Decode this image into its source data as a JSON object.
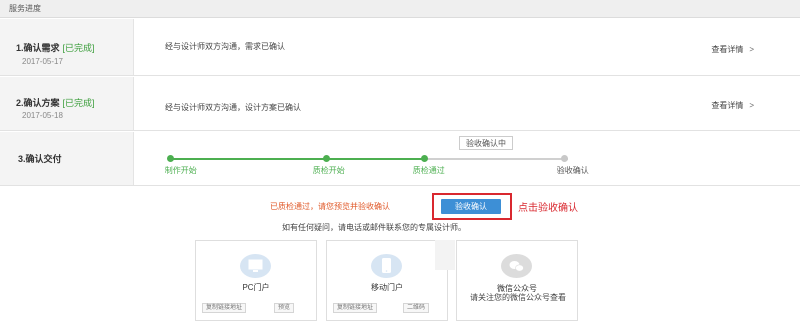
{
  "header": {
    "title": "服务进度"
  },
  "steps": [
    {
      "title": "1.确认需求",
      "status": "[已完成]",
      "date": "2017-05-17",
      "description": "经与设计师双方沟通，需求已确认",
      "detail": "查看详情",
      "chevron": ">"
    },
    {
      "title": "2.确认方案",
      "status": "[已完成]",
      "date": "2017-05-18",
      "description": "经与设计师双方沟通，设计方案已确认",
      "detail": "查看详情",
      "chevron": ">"
    },
    {
      "title": "3.确认交付"
    }
  ],
  "delivery": {
    "tip": "验收确认中",
    "stages": [
      {
        "label": "制作开始",
        "state": "done"
      },
      {
        "label": "质检开始",
        "state": "done"
      },
      {
        "label": "质检通过",
        "state": "done"
      },
      {
        "label": "验收确认",
        "state": "pending"
      }
    ]
  },
  "action": {
    "notice": "已质检通过，请您预览并验收确认",
    "confirm_button": "验收确认",
    "callout": "点击验收确认",
    "help": "如有任何疑问，请电话或邮件联系您的专属设计师。"
  },
  "cards": [
    {
      "title": "PC门户",
      "icon": "monitor-icon",
      "buttons": [
        "复制链接地址",
        "预览"
      ]
    },
    {
      "title": "移动门户",
      "icon": "mobile-icon",
      "buttons": [
        "复制链接地址",
        "二维码"
      ]
    },
    {
      "title": "微信公众号",
      "icon": "wechat-icon",
      "subtitle": "请关注您的微信公众号查看"
    }
  ],
  "colors": {
    "accent": "#3d8fd6",
    "success": "#4caf50",
    "warning": "#e05a2a",
    "highlight": "#d9282f"
  }
}
